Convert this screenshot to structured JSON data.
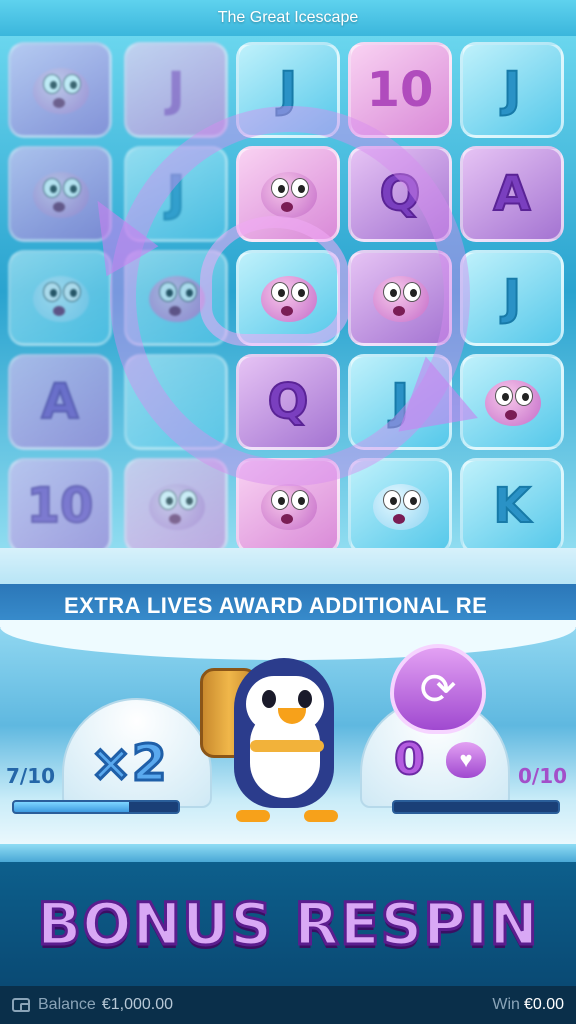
{
  "header": {
    "title": "The Great Icescape"
  },
  "reels": {
    "columns": [
      {
        "tiles": [
          {
            "kind": "fish",
            "label": ""
          },
          {
            "kind": "fish",
            "label": ""
          },
          {
            "kind": "fish",
            "label": ""
          },
          {
            "kind": "symbol",
            "label": "A"
          },
          {
            "kind": "symbol",
            "label": "10"
          }
        ]
      },
      {
        "tiles": [
          {
            "kind": "symbol",
            "label": "J"
          },
          {
            "kind": "symbol",
            "label": "J"
          },
          {
            "kind": "fish",
            "label": ""
          },
          {
            "kind": "symbol",
            "label": ""
          },
          {
            "kind": "fish",
            "label": ""
          }
        ]
      },
      {
        "tiles": [
          {
            "kind": "symbol",
            "label": "J"
          },
          {
            "kind": "fish",
            "label": ""
          },
          {
            "kind": "fish",
            "label": ""
          },
          {
            "kind": "symbol",
            "label": "Q"
          },
          {
            "kind": "fish",
            "label": ""
          }
        ]
      },
      {
        "tiles": [
          {
            "kind": "symbol",
            "label": "10"
          },
          {
            "kind": "symbol",
            "label": "Q"
          },
          {
            "kind": "fish",
            "label": ""
          },
          {
            "kind": "symbol",
            "label": "J"
          },
          {
            "kind": "fish",
            "label": ""
          }
        ]
      },
      {
        "tiles": [
          {
            "kind": "symbol",
            "label": "J"
          },
          {
            "kind": "symbol",
            "label": "A"
          },
          {
            "kind": "symbol",
            "label": "J"
          },
          {
            "kind": "fish",
            "label": ""
          },
          {
            "kind": "symbol",
            "label": "K"
          }
        ]
      }
    ]
  },
  "banner": {
    "text": "EXTRA LIVES AWARD ADDITIONAL RE"
  },
  "left_meter": {
    "multiplier": "×2",
    "counter": "7/10",
    "progress": 0.7
  },
  "right_meter": {
    "heart_icon": "refresh-icon",
    "lives": "0",
    "counter": "0/10",
    "progress": 0.0
  },
  "bonus": {
    "text": "BONUS RESPIN"
  },
  "footer": {
    "balance_label": "Balance",
    "balance_value": "€1,000.00",
    "win_label": "Win",
    "win_value": "€0.00"
  },
  "colors": {
    "accent_purple": "#b45ce0",
    "accent_blue": "#3d9be0",
    "bonus_text": "#d9a8f5"
  }
}
